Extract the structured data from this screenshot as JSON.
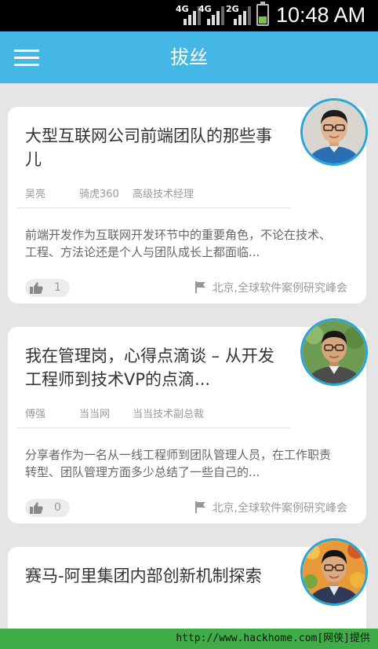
{
  "status_bar": {
    "network_1": "4G",
    "network_2": "4G",
    "network_3": "2G",
    "time": "10:48 AM",
    "battery_color": "#7fc241"
  },
  "app_bar": {
    "title": "拔丝",
    "menu_icon": "hamburger-menu-icon",
    "color": "#45b7e6"
  },
  "talks": [
    {
      "title": "大型互联网公司前端团队的那些事儿",
      "speaker": "吴亮",
      "company": "骑虎360",
      "role": "高级技术经理",
      "summary": "前端开发作为互联网开发环节中的重要角色，不论在技术、工程、方法论还是个人与团队成长上都面临...",
      "likes": "1",
      "venue": "北京,全球软件案例研究峰会"
    },
    {
      "title": "我在管理岗，心得点滴谈 – 从开发工程师到技术VP的点滴...",
      "speaker": "傅强",
      "company": "当当网",
      "role": "当当技术副总裁",
      "summary": "分享者作为一名从一线工程师到团队管理人员，在工作职责转型、团队管理方面多少总结了一些自己的...",
      "likes": "0",
      "venue": "北京,全球软件案例研究峰会"
    },
    {
      "title": "赛马-阿里集团内部创新机制探索"
    }
  ],
  "watermark": "http://www.hackhome.com[网侠]提供"
}
